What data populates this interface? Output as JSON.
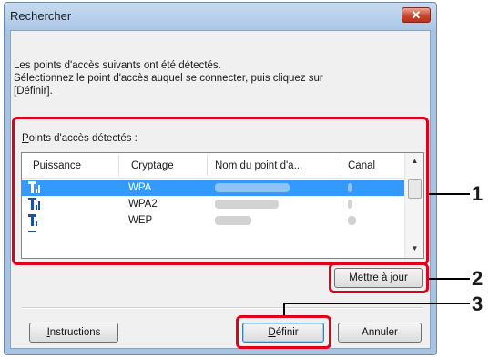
{
  "window": {
    "title": "Rechercher"
  },
  "message": {
    "line1": "Les points d'accès suivants ont été détectés.",
    "line2": "Sélectionnez le point d'accès auquel se connecter, puis cliquez sur",
    "line3": "[Définir]."
  },
  "group": {
    "label_accel": "P",
    "label_rest": "oints d'accès détectés :"
  },
  "columns": [
    "Puissance",
    "Cryptage",
    "Nom du point d'a...",
    "Canal"
  ],
  "rows": [
    {
      "encryption": "WPA",
      "selected": true
    },
    {
      "encryption": "WPA2",
      "selected": false
    },
    {
      "encryption": "WEP",
      "selected": false
    }
  ],
  "buttons": {
    "refresh": {
      "accel": "M",
      "rest": "ettre à jour"
    },
    "instructions": {
      "accel": "I",
      "rest": "nstructions"
    },
    "define": {
      "accel": "D",
      "rest": "éfinir"
    },
    "cancel": "Annuler"
  },
  "callouts": [
    "1",
    "2",
    "3"
  ],
  "colors": {
    "highlight": "#e0001a",
    "selection": "#3399ff",
    "signal": "#1f4fa8"
  }
}
